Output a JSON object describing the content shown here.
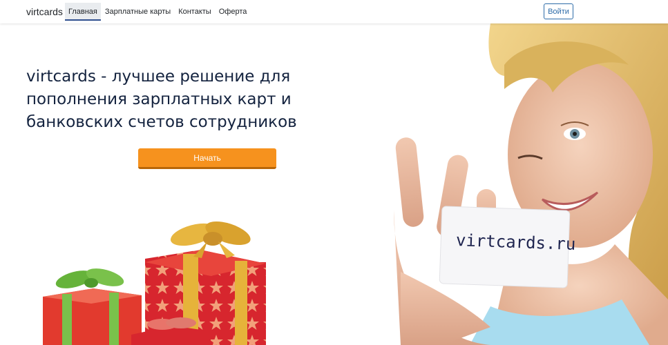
{
  "navbar": {
    "brand": "virtcards",
    "links": [
      {
        "label": "Главная",
        "active": true
      },
      {
        "label": "Зарплатные карты",
        "active": false
      },
      {
        "label": "Контакты",
        "active": false
      },
      {
        "label": "Оферта",
        "active": false
      }
    ],
    "login_label": "Войти"
  },
  "hero": {
    "headline": "virtcards - лучшее решение для пополнения зарплатных карт и банковских счетов сотрудников",
    "start_label": "Начать",
    "card_text": "virtcards.ru"
  },
  "colors": {
    "accent_orange": "#f6921e",
    "headline_navy": "#14233f",
    "login_blue": "#2d6ba8"
  }
}
